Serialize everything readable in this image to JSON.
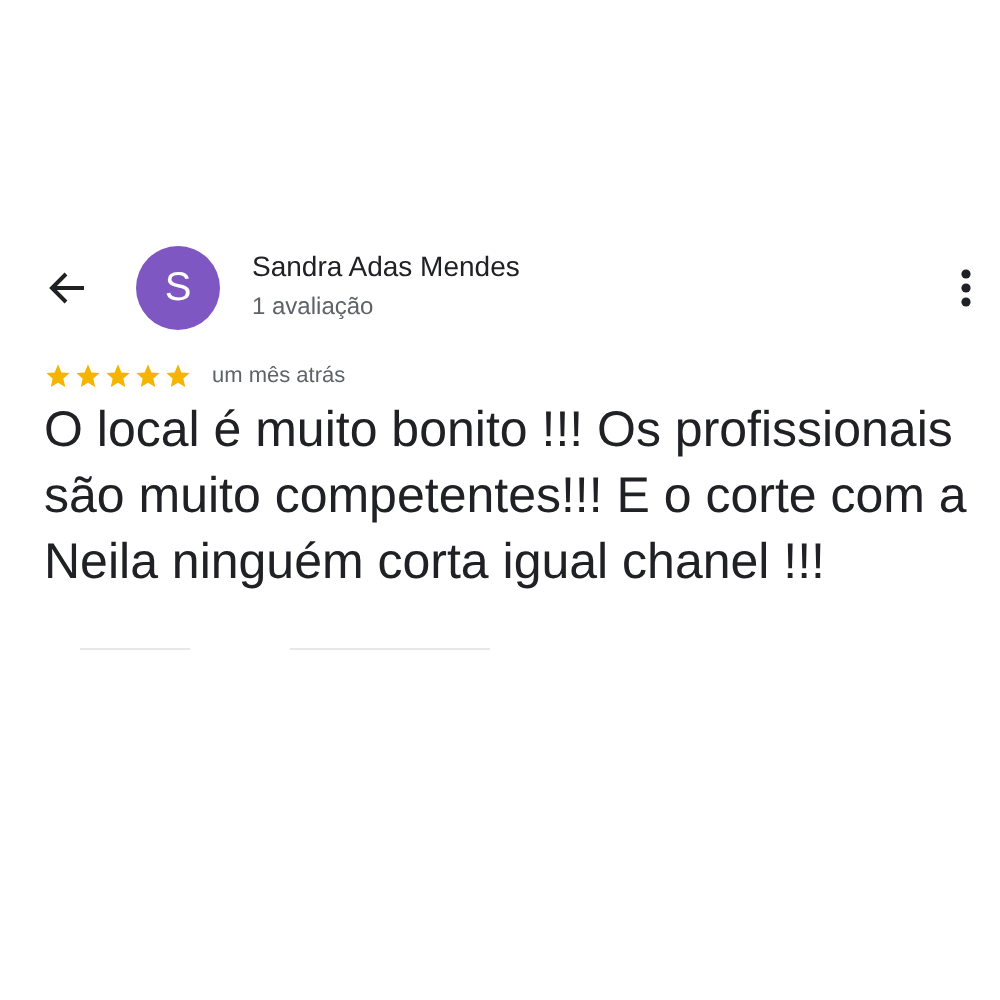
{
  "reviewer": {
    "avatar_letter": "S",
    "name": "Sandra Adas Mendes",
    "subtitle": "1 avaliação"
  },
  "review": {
    "stars": 5,
    "time": "um mês atrás",
    "text": "O local é muito bonito !!! Os profissionais são muito competentes!!! E o corte com a Neila ninguém corta igual chanel !!!"
  }
}
